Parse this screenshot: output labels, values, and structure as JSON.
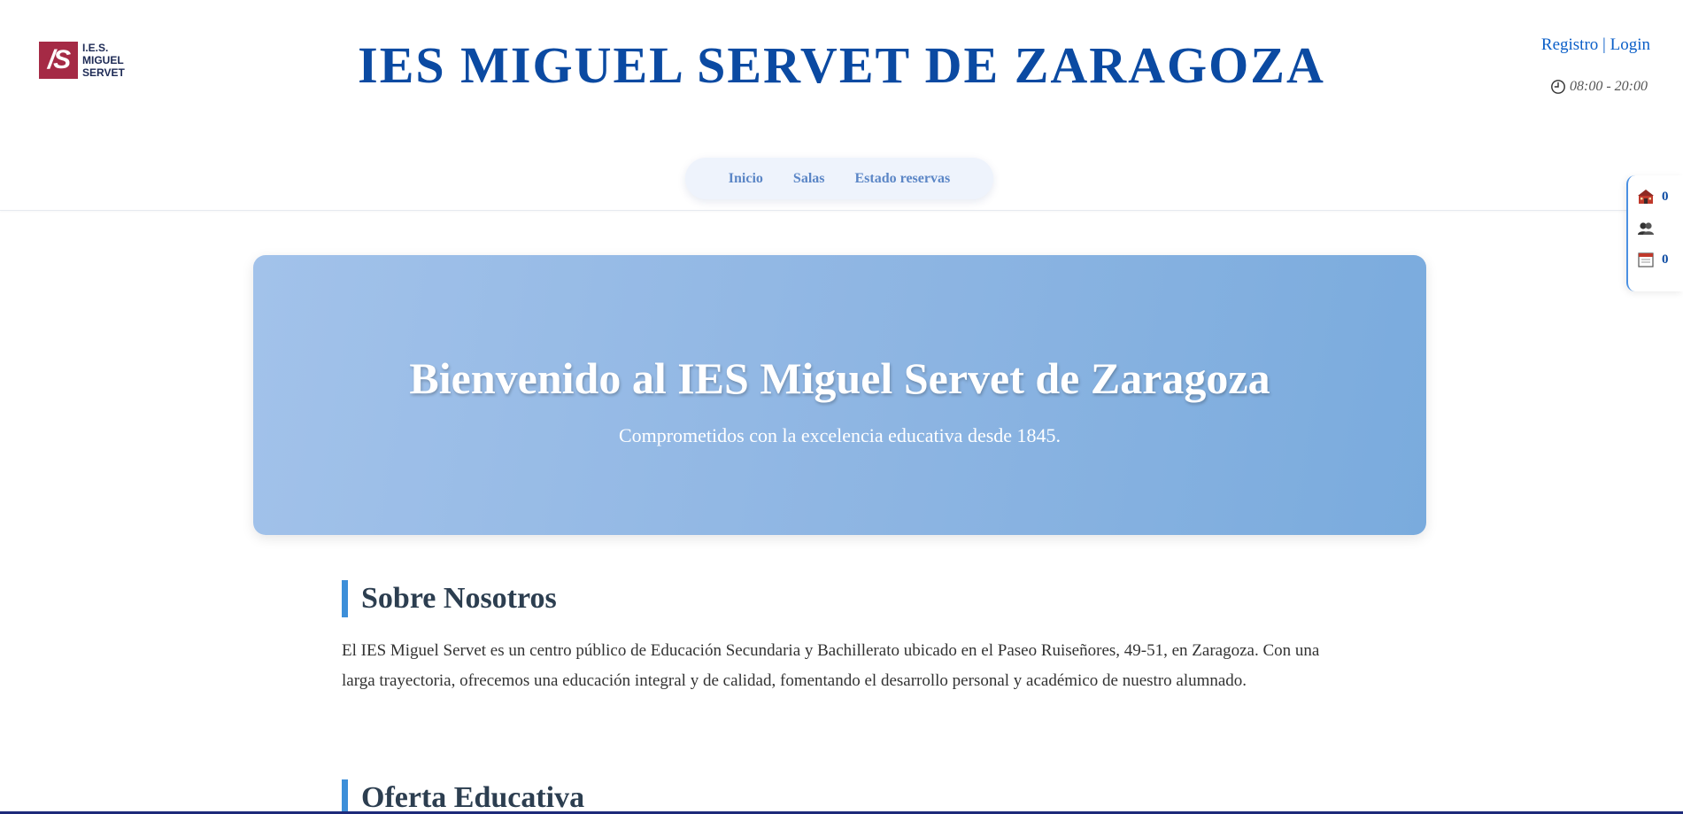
{
  "header": {
    "logo": {
      "mark": "/S",
      "lines": [
        "I.E.S.",
        "MIGUEL",
        "SERVET"
      ]
    },
    "title": "IES MIGUEL SERVET DE ZARAGOZA",
    "auth": {
      "register": "Registro",
      "separator": "|",
      "login": "Login"
    },
    "hours": "08:00 - 20:00",
    "hours_icon": "clock-icon"
  },
  "nav": {
    "items": [
      {
        "label": "Inicio"
      },
      {
        "label": "Salas"
      },
      {
        "label": "Estado reservas"
      }
    ]
  },
  "side_widget": {
    "rooms": {
      "icon": "school-building-icon",
      "count": "0"
    },
    "users": {
      "icon": "users-icon"
    },
    "bookings": {
      "icon": "calendar-icon",
      "count": "0"
    }
  },
  "hero": {
    "title": "Bienvenido al IES Miguel Servet de Zaragoza",
    "subtitle": "Comprometidos con la excelencia educativa desde 1845."
  },
  "sections": {
    "about": {
      "title": "Sobre Nosotros",
      "text": "El IES Miguel Servet es un centro público de Educación Secundaria y Bachillerato ubicado en el Paseo Ruiseñores, 49-51, en Zaragoza. Con una larga trayectoria, ofrecemos una educación integral y de calidad, fomentando el desarrollo personal y académico de nuestro alumnado."
    },
    "offer": {
      "title": "Oferta Educativa"
    }
  },
  "colors": {
    "title_blue": "#0b4aa2",
    "link_blue": "#0b5fc8",
    "accent": "#3d8fd9",
    "logo_red": "#a52a45"
  }
}
